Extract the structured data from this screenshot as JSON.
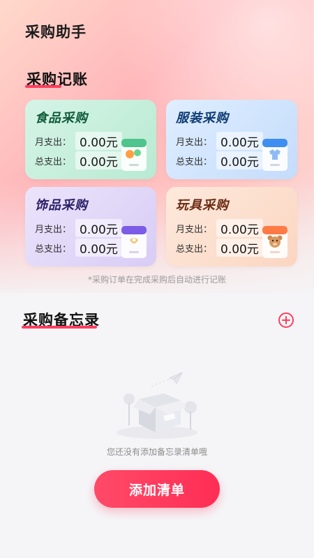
{
  "app": {
    "title": "采购助手"
  },
  "ledger": {
    "section_title": "采购记账",
    "cards": [
      {
        "title": "食品采购",
        "title_color": "#0f5b3a",
        "bg_from": "#d6f4e6",
        "bg_to": "#b8ead2",
        "monthly_label": "月支出：",
        "monthly_value": "0.00元",
        "total_label": "总支出：",
        "total_value": "0.00元",
        "icon": "food-bag-icon"
      },
      {
        "title": "服装采购",
        "title_color": "#0d3a73",
        "bg_from": "#dfeeff",
        "bg_to": "#c4dcfb",
        "monthly_label": "月支出：",
        "monthly_value": "0.00元",
        "total_label": "总支出：",
        "total_value": "0.00元",
        "icon": "clothes-bag-icon"
      },
      {
        "title": "饰品采购",
        "title_color": "#2b1f66",
        "bg_from": "#ebe4fb",
        "bg_to": "#d8ccf5",
        "monthly_label": "月支出：",
        "monthly_value": "0.00元",
        "total_label": "总支出：",
        "total_value": "0.00元",
        "icon": "accessory-bag-icon"
      },
      {
        "title": "玩具采购",
        "title_color": "#6a2b12",
        "bg_from": "#fde9dc",
        "bg_to": "#fbd6c1",
        "monthly_label": "月支出：",
        "monthly_value": "0.00元",
        "total_label": "总支出：",
        "total_value": "0.00元",
        "icon": "toy-bag-icon"
      }
    ],
    "note": "*采购订单在完成采购后自动进行记账"
  },
  "memo": {
    "section_title": "采购备忘录",
    "add_icon": "plus-circle-icon",
    "empty_text": "您还没有添加备忘录清单哦",
    "add_button": "添加清单"
  },
  "colors": {
    "accent": "#ff3d5e",
    "button": "#ff2d55"
  }
}
